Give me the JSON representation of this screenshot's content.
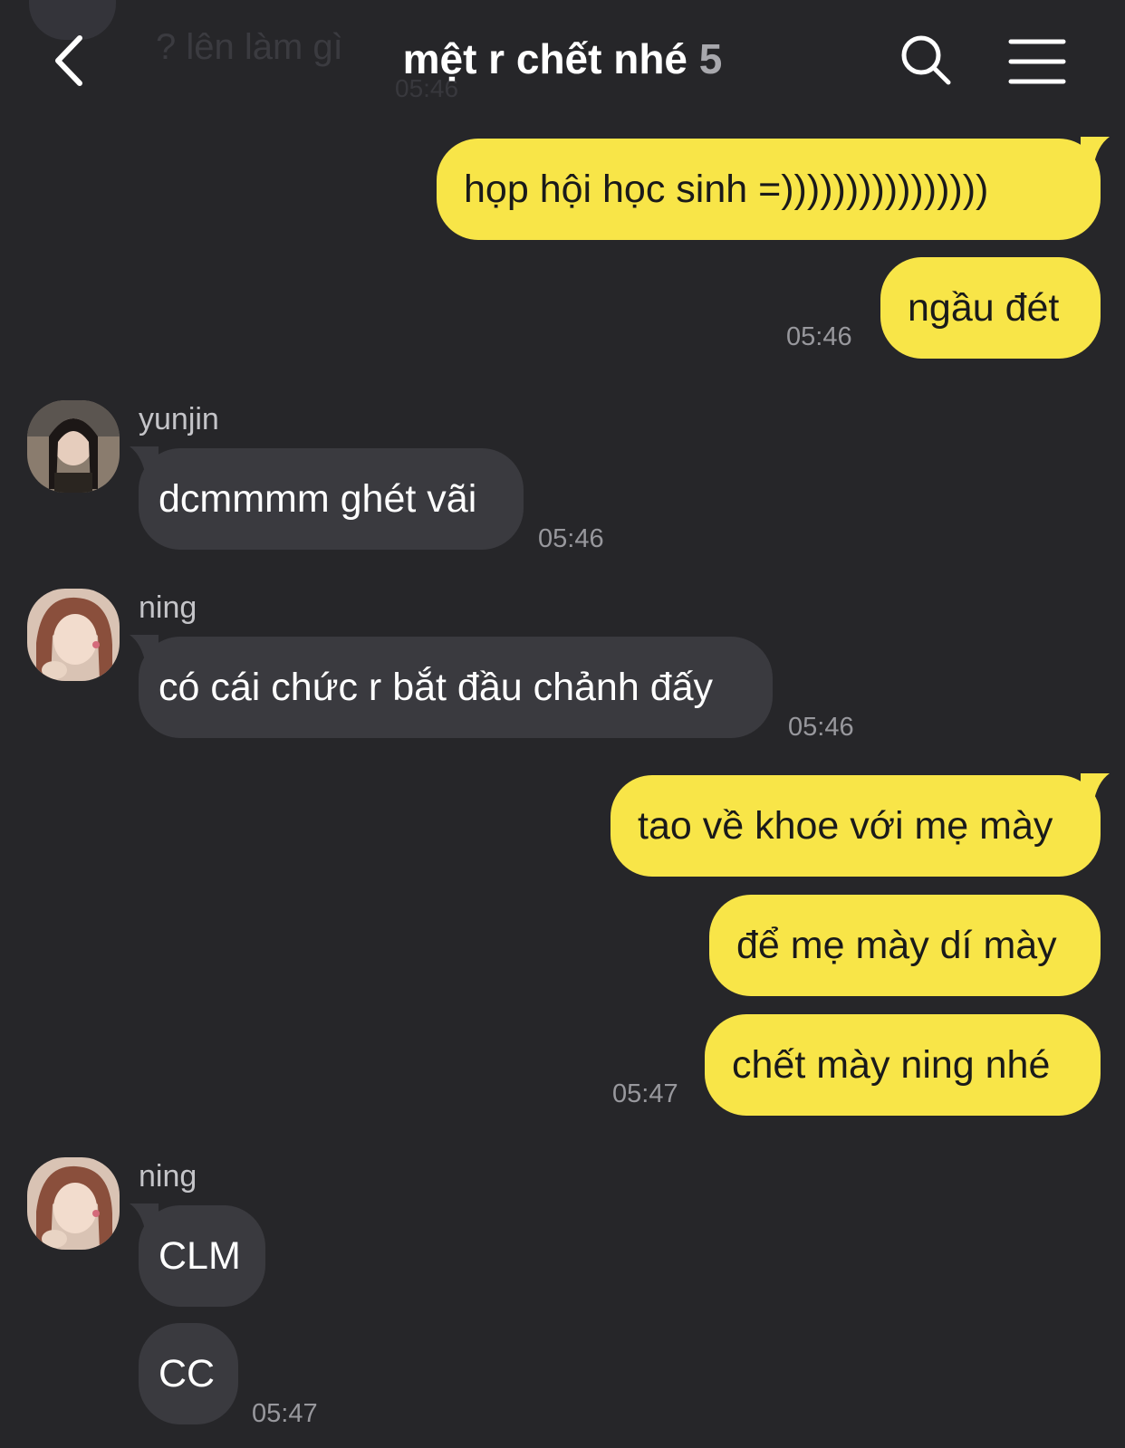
{
  "header": {
    "title": "mệt r chết nhé",
    "member_count": "5",
    "faded_preview": "? lên làm gì",
    "faded_time": "05:46"
  },
  "messages": {
    "m1": "họp hội học sinh =))))))))))))))))",
    "m2": "ngầu đét",
    "m2_time": "05:46",
    "m3_sender": "yunjin",
    "m3": "dcmmmm ghét vãi",
    "m3_time": "05:46",
    "m4_sender": "ning",
    "m4": "có cái chức r bắt đầu chảnh đấy",
    "m4_time": "05:46",
    "m5": "tao về khoe với mẹ mày",
    "m6": "để mẹ mày dí mày",
    "m7": "chết mày ning nhé",
    "m7_time": "05:47",
    "m8_sender": "ning",
    "m8": "CLM",
    "m9": "CC",
    "m9_time": "05:47"
  },
  "icons": {
    "back": "chevron-left-icon",
    "search": "search-icon",
    "menu": "hamburger-menu-icon"
  },
  "colors": {
    "background": "#262629",
    "my_bubble": "#f8e548",
    "their_bubble": "#3a3a3f",
    "timestamp": "#98989d"
  }
}
